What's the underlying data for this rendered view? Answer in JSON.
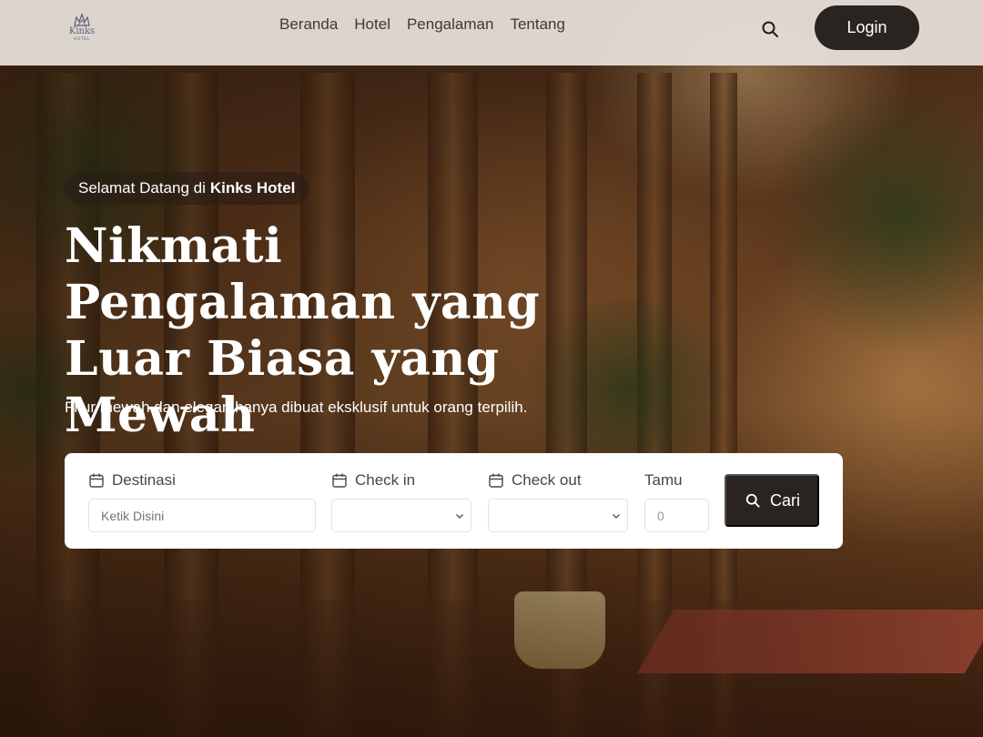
{
  "header": {
    "logo_text": "Kinks",
    "logo_subtext": "HOTEL",
    "nav": [
      "Beranda",
      "Hotel",
      "Pengalaman",
      "Tentang"
    ],
    "search_icon": "search-icon",
    "login_label": "Login"
  },
  "hero": {
    "badge_prefix": "Selamat Datang di",
    "badge_brand": "Kinks Hotel",
    "headline": "Nikmati Pengalaman yang Luar Biasa yang Mewah",
    "subtitle": "Fitur mewah dan elegan hanya dibuat eksklusif untuk orang terpilih."
  },
  "search_form": {
    "destination": {
      "label": "Destinasi",
      "placeholder": "Ketik Disini",
      "icon": "calendar-icon"
    },
    "check_in": {
      "label": "Check in",
      "value": "",
      "icon": "calendar-icon"
    },
    "check_out": {
      "label": "Check out",
      "value": "",
      "icon": "calendar-icon"
    },
    "guests": {
      "label": "Tamu",
      "value": "0"
    },
    "submit_label": "Cari",
    "submit_icon": "search-icon"
  },
  "colors": {
    "primary_dark": "#2a2421",
    "navbar_bg": "#e8e2dc",
    "text_dark": "#3d3a3a"
  }
}
